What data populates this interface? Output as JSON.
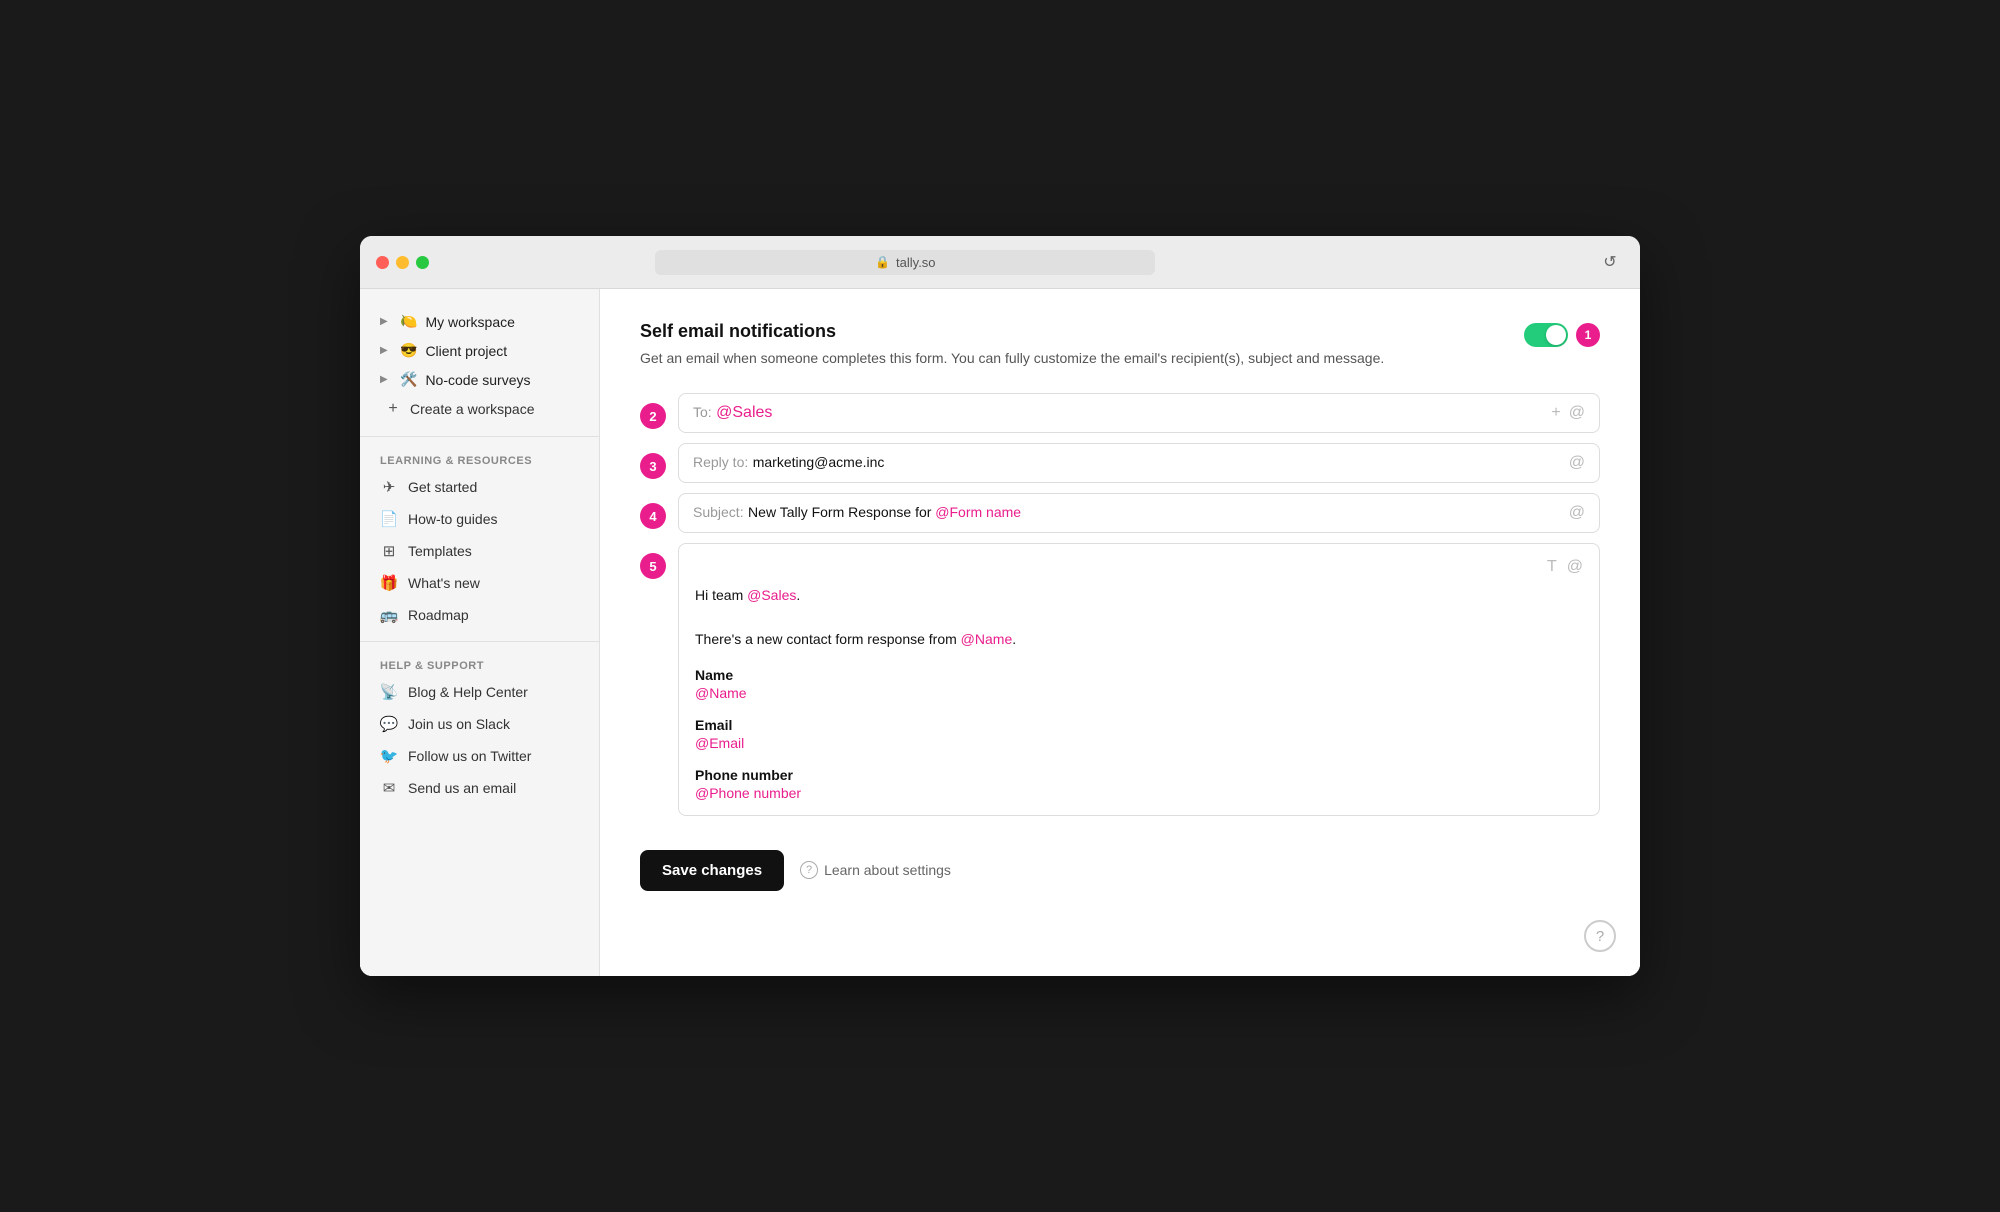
{
  "browser": {
    "url": "tally.so",
    "reload_label": "↺"
  },
  "sidebar": {
    "workspaces": [
      {
        "emoji": "🍋",
        "label": "My workspace"
      },
      {
        "emoji": "😎",
        "label": "Client project"
      },
      {
        "emoji": "🛠️",
        "label": "No-code surveys"
      }
    ],
    "create_label": "Create a workspace",
    "learning_section": "LEARNING & RESOURCES",
    "learning_items": [
      {
        "icon": "✈",
        "label": "Get started"
      },
      {
        "icon": "📄",
        "label": "How-to guides"
      },
      {
        "icon": "⊞",
        "label": "Templates"
      },
      {
        "icon": "🎁",
        "label": "What's new"
      },
      {
        "icon": "🚌",
        "label": "Roadmap"
      }
    ],
    "support_section": "HELP & SUPPORT",
    "support_items": [
      {
        "icon": "📡",
        "label": "Blog & Help Center"
      },
      {
        "icon": "💬",
        "label": "Join us on Slack"
      },
      {
        "icon": "🐦",
        "label": "Follow us on Twitter"
      },
      {
        "icon": "✉",
        "label": "Send us an email"
      }
    ]
  },
  "main": {
    "title": "Self email notifications",
    "description": "Get an email when someone completes this form. You can fully customize the email's recipient(s), subject and message.",
    "toggle_on": true,
    "badge_count": "1",
    "steps": [
      {
        "number": "2",
        "field_label": "To:",
        "field_value": "@Sales",
        "show_plus": true,
        "show_at": true
      },
      {
        "number": "3",
        "field_label": "Reply to:",
        "field_value": "marketing@acme.inc",
        "show_at": true
      },
      {
        "number": "4",
        "field_label": "Subject:",
        "field_value": "New Tally Form Response for @Form name",
        "show_at": true
      }
    ],
    "message_step": "5",
    "message_lines": [
      "Hi team @Sales.",
      "",
      "There's a new contact form response from @Name."
    ],
    "message_fields": [
      {
        "label": "Name",
        "value": "@Name"
      },
      {
        "label": "Email",
        "value": "@Email"
      },
      {
        "label": "Phone number",
        "value": "@Phone number"
      }
    ],
    "save_label": "Save changes",
    "learn_label": "Learn about settings",
    "help_icon": "?"
  }
}
